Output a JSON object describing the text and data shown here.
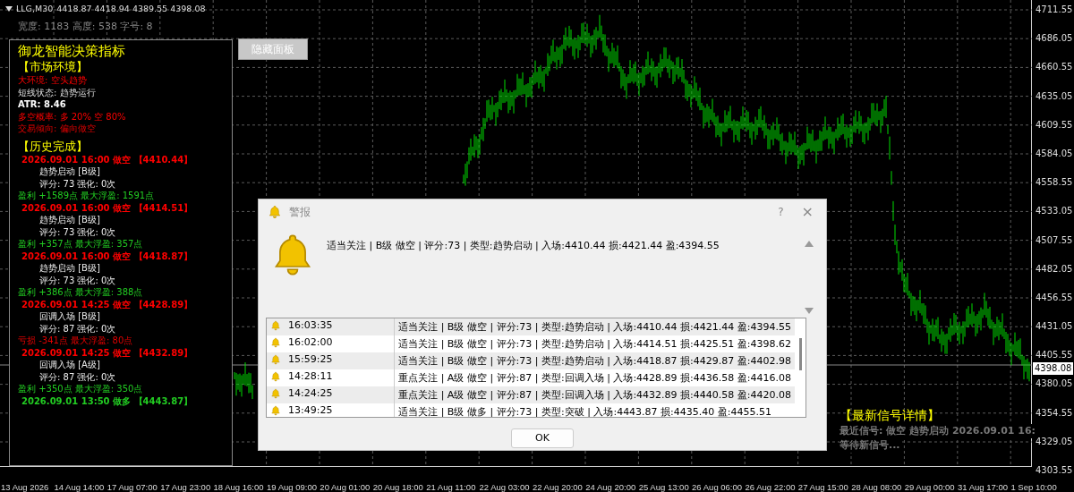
{
  "chart_header": {
    "symbol": "LLG,M30",
    "quote": "4418.87 4418.94 4389.55 4398.08",
    "dimensions": "宽度: 1183 高度: 538 字号: 8"
  },
  "hide_panel_button": "隐藏面板",
  "panel": {
    "title": "御龙智能决策指标",
    "market": {
      "heading": "【市场环境】",
      "lines": [
        {
          "text": "大环境: 空头趋势",
          "kind": "alert"
        },
        {
          "text": "短线状态: 趋势运行",
          "kind": "plain"
        },
        {
          "text": "ATR: 8.46",
          "kind": "strong"
        },
        {
          "text": "多空概率: 多 20%  空 80%",
          "kind": "alert"
        },
        {
          "text": "交易倾向: 偏向做空",
          "kind": "warning"
        }
      ]
    },
    "history": {
      "heading": "【历史完成】",
      "trades": [
        {
          "signal": {
            "text": "2026.09.01 16:00 做空 【4410.44】",
            "color": "#ff0000"
          },
          "setup": "趋势启动 [B级]",
          "score": "评分: 73  强化: 0次",
          "result": {
            "text": "盈利 +1589点  最大浮盈: 1591点",
            "color": "#22cc22"
          }
        },
        {
          "signal": {
            "text": "2026.09.01 16:00 做空 【4414.51】",
            "color": "#ff0000"
          },
          "setup": "趋势启动 [B级]",
          "score": "评分: 73  强化: 0次",
          "result": {
            "text": "盈利 +357点  最大浮盈: 357点",
            "color": "#22cc22"
          }
        },
        {
          "signal": {
            "text": "2026.09.01 16:00 做空 【4418.87】",
            "color": "#ff0000"
          },
          "setup": "趋势启动 [B级]",
          "score": "评分: 73  强化: 0次",
          "result": {
            "text": "盈利 +386点  最大浮盈: 388点",
            "color": "#22cc22"
          }
        },
        {
          "signal": {
            "text": "2026.09.01 14:25 做空 【4428.89】",
            "color": "#ff0000"
          },
          "setup": "回调入场 [B级]",
          "score": "评分: 87  强化: 0次",
          "result": {
            "text": "亏损 -341点  最大浮盈: 80点",
            "color": "#e00000"
          }
        },
        {
          "signal": {
            "text": "2026.09.01 14:25 做空 【4432.89】",
            "color": "#ff0000"
          },
          "setup": "回调入场 [A级]",
          "score": "评分: 87  强化: 0次",
          "result": {
            "text": "盈利 +350点  最大浮盈: 350点",
            "color": "#22cc22"
          }
        },
        {
          "signal": {
            "text": "2026.09.01 13:50 做多 【4443.87】",
            "color": "#22cc22"
          }
        }
      ]
    }
  },
  "price_axis": [
    "4711.55",
    "4686.05",
    "4660.55",
    "4635.05",
    "4609.55",
    "4584.05",
    "4558.55",
    "4533.05",
    "4507.55",
    "4482.05",
    "4456.55",
    "4431.05",
    "4405.55",
    "4380.05",
    "4354.55",
    "4329.05",
    "4303.55"
  ],
  "current_price": "4398.08",
  "time_axis": [
    "13 Aug 2026",
    "14 Aug 14:00",
    "17 Aug 07:00",
    "17 Aug 23:00",
    "18 Aug 16:00",
    "19 Aug 09:00",
    "20 Aug 01:00",
    "20 Aug 18:00",
    "21 Aug 11:00",
    "22 Aug 03:00",
    "22 Aug 20:00",
    "24 Aug 20:00",
    "25 Aug 13:00",
    "26 Aug 06:00",
    "26 Aug 22:00",
    "27 Aug 15:00",
    "28 Aug 08:00",
    "29 Aug 00:00",
    "31 Aug 17:00",
    "1 Sep 10:00"
  ],
  "latest_signal": {
    "heading": "【最新信号详情】",
    "lines": [
      "最近信号: 做空 趋势启动 2026.09.01 16:",
      "等待新信号..."
    ]
  },
  "alert_dialog": {
    "title": "警报",
    "help": "?",
    "close": "×",
    "message": "适当关注 | B级 做空 | 评分:73 | 类型:趋势启动 | 入场:4410.44 损:4421.44 盈:4394.55",
    "rows": [
      {
        "time": "16:03:35",
        "text": "适当关注 | B级 做空 | 评分:73 | 类型:趋势启动 | 入场:4410.44 损:4421.44 盈:4394.55"
      },
      {
        "time": "16:02:00",
        "text": "适当关注 | B级 做空 | 评分:73 | 类型:趋势启动 | 入场:4414.51 损:4425.51 盈:4398.62"
      },
      {
        "time": "15:59:25",
        "text": "适当关注 | B级 做空 | 评分:73 | 类型:趋势启动 | 入场:4418.87 损:4429.87 盈:4402.98"
      },
      {
        "time": "14:28:11",
        "text": "重点关注 | A级 做空 | 评分:87 | 类型:回调入场 | 入场:4428.89 损:4436.58 盈:4416.08"
      },
      {
        "time": "14:24:25",
        "text": "重点关注 | A级 做空 | 评分:87 | 类型:回调入场 | 入场:4432.89 损:4440.58 盈:4420.08"
      },
      {
        "time": "13:49:25",
        "text": "适当关注 | B级 做多 | 评分:73 | 类型:突破 | 入场:4443.87 损:4435.40 盈:4455.51"
      }
    ],
    "ok": "OK"
  }
}
